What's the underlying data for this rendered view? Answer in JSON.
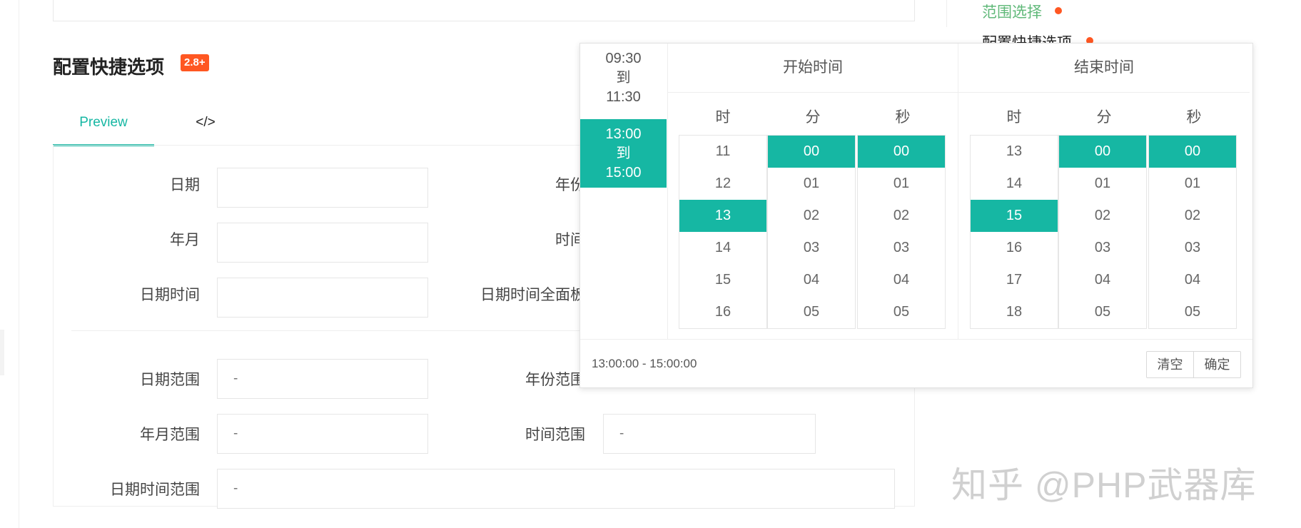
{
  "section": {
    "title": "配置快捷选项",
    "badge": "2.8+"
  },
  "tabs": [
    {
      "label": "Preview"
    },
    {
      "label": "</>"
    }
  ],
  "form": {
    "date": {
      "label": "日期",
      "value": ""
    },
    "year": {
      "label": "年份",
      "value": ""
    },
    "year_month": {
      "label": "年月",
      "value": ""
    },
    "time": {
      "label": "时间",
      "value": ""
    },
    "datetime": {
      "label": "日期时间",
      "value": ""
    },
    "datetime_full": {
      "label": "日期时间全面板",
      "value": ""
    },
    "date_range": {
      "label": "日期范围",
      "value": "-"
    },
    "year_range": {
      "label": "年份范围",
      "value": "-"
    },
    "year_month_range": {
      "label": "年月范围",
      "value": "-"
    },
    "time_range": {
      "label": "时间范围",
      "value": "-"
    },
    "datetime_range": {
      "label": "日期时间范围",
      "value": "-"
    }
  },
  "side_nav": {
    "items": [
      {
        "label": "范围选择"
      },
      {
        "label": "配置快捷选项"
      }
    ],
    "active_color": "#5fb878",
    "dot_color": "#ff5722"
  },
  "popup": {
    "shortcuts": [
      {
        "from": "09:30",
        "sep": "到",
        "to": "11:30"
      },
      {
        "from": "13:00",
        "sep": "到",
        "to": "15:00"
      }
    ],
    "start": {
      "title": "开始时间",
      "col_labels": [
        "时",
        "分",
        "秒"
      ],
      "hours": [
        "11",
        "12",
        "13",
        "14",
        "15",
        "16"
      ],
      "minutes": [
        "00",
        "01",
        "02",
        "03",
        "04",
        "05"
      ],
      "seconds": [
        "00",
        "01",
        "02",
        "03",
        "04",
        "05"
      ],
      "selected": {
        "hour": "13",
        "minute": "00",
        "second": "00"
      }
    },
    "end": {
      "title": "结束时间",
      "col_labels": [
        "时",
        "分",
        "秒"
      ],
      "hours": [
        "13",
        "14",
        "15",
        "16",
        "17",
        "18"
      ],
      "minutes": [
        "00",
        "01",
        "02",
        "03",
        "04",
        "05"
      ],
      "seconds": [
        "00",
        "01",
        "02",
        "03",
        "04",
        "05"
      ],
      "selected": {
        "hour": "15",
        "minute": "00",
        "second": "00"
      }
    },
    "footer_value": "13:00:00 - 15:00:00",
    "clear_label": "清空",
    "confirm_label": "确定",
    "accent_color": "#16b7a3"
  },
  "watermark": "知乎 @PHP武器库"
}
